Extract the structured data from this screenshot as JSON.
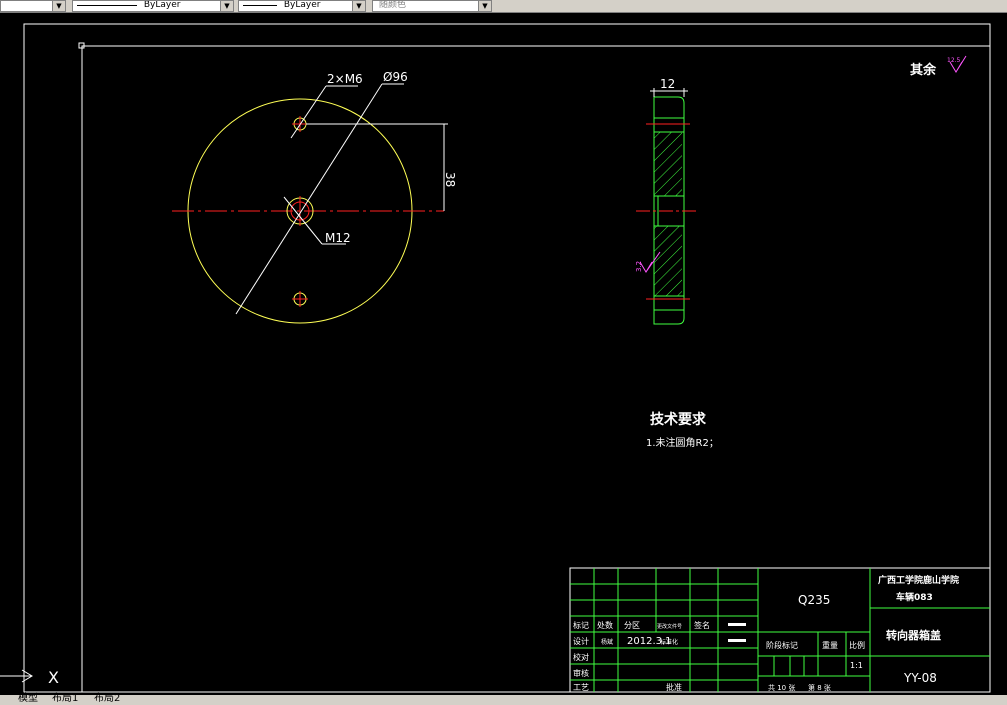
{
  "toolbar": {
    "linetype_1": "ByLayer",
    "linetype_2": "ByLayer",
    "color": "随颜色"
  },
  "drawing": {
    "holes_label": "2×M6",
    "diameter_label": "Ø96",
    "center_thread_label": "M12",
    "distance_label": "38",
    "thickness_label": "12",
    "roughness_other": "其余",
    "roughness_value": "12.5",
    "roughness_side": "3.2",
    "tech_req_title": "技术要求",
    "tech_req_item": "1.未注圆角R2；"
  },
  "title_block": {
    "material": "Q235",
    "school": "广西工学院鹿山学院",
    "class": "车辆083",
    "part_name": "转向器箱盖",
    "drawing_no": "YY-08",
    "date": "2012.3.1",
    "scale": "1:1",
    "sheets": "共 10 张",
    "sheet": "第 8 张",
    "headers": [
      "标记",
      "处数",
      "分区",
      "更改文件号",
      "签名"
    ],
    "design": "设计",
    "designer": "杨斌",
    "standard": "标准化",
    "check": "校对",
    "review": "审核",
    "process": "工艺",
    "approve": "批准",
    "stage_mark": "阶段标记",
    "weight": "重量",
    "ratio": "比例"
  },
  "tabs": {
    "model": "模型",
    "layout1": "布局1",
    "layout2": "布局2"
  },
  "ucs": {
    "x_label": "X"
  },
  "colors": {
    "frame": "#ffffff",
    "part": "#ffff55",
    "center": "#ff2020",
    "dim": "#ffffff",
    "hatch": "#40ff40",
    "roughness": "#ff55ff"
  }
}
